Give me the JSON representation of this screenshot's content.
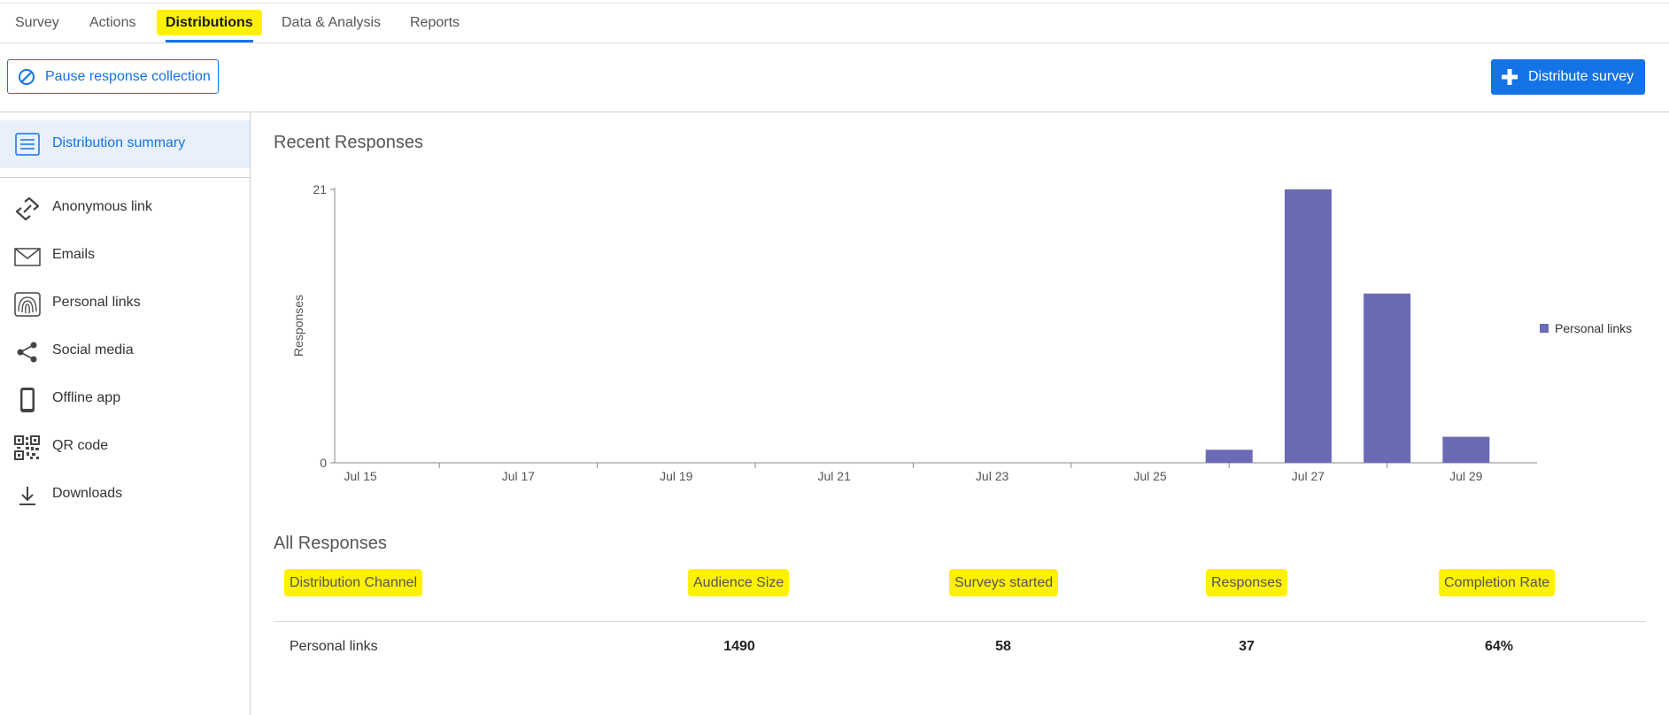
{
  "tabs": [
    {
      "label": "Survey"
    },
    {
      "label": "Actions"
    },
    {
      "label": "Distributions"
    },
    {
      "label": "Data & Analysis"
    },
    {
      "label": "Reports"
    }
  ],
  "toolbar": {
    "pause_label": "Pause response collection",
    "distribute_label": "Distribute survey"
  },
  "sidebar": {
    "summary_label": "Distribution summary",
    "items": [
      {
        "label": "Anonymous link",
        "icon": "link-icon"
      },
      {
        "label": "Emails",
        "icon": "envelope-icon"
      },
      {
        "label": "Personal links",
        "icon": "fingerprint-icon"
      },
      {
        "label": "Social media",
        "icon": "share-icon"
      },
      {
        "label": "Offline app",
        "icon": "phone-icon"
      },
      {
        "label": "QR code",
        "icon": "qr-code-icon"
      },
      {
        "label": "Downloads",
        "icon": "download-icon"
      }
    ]
  },
  "recent_title": "Recent Responses",
  "all_title": "All Responses",
  "chart_data": {
    "type": "bar",
    "categories": [
      "Jul 15",
      "Jul 16",
      "Jul 17",
      "Jul 18",
      "Jul 19",
      "Jul 20",
      "Jul 21",
      "Jul 22",
      "Jul 23",
      "Jul 24",
      "Jul 25",
      "Jul 26",
      "Jul 27",
      "Jul 28",
      "Jul 29"
    ],
    "tick_labels": [
      "Jul 15",
      "Jul 17",
      "Jul 19",
      "Jul 21",
      "Jul 23",
      "Jul 25",
      "Jul 27",
      "Jul 29"
    ],
    "series": [
      {
        "name": "Personal links",
        "values": [
          0,
          0,
          0,
          0,
          0,
          0,
          0,
          0,
          0,
          0,
          0,
          1,
          21,
          13,
          2
        ],
        "color": "#6b6bb5"
      }
    ],
    "ylabel": "Responses",
    "yticks": [
      0,
      21
    ],
    "ylim": [
      0,
      21
    ],
    "legend": "right"
  },
  "table": {
    "headers": [
      "Distribution Channel",
      "Audience Size",
      "Surveys started",
      "Responses",
      "Completion Rate"
    ],
    "rows": [
      {
        "channel": "Personal links",
        "audience": "1490",
        "started": "58",
        "responses": "37",
        "rate": "64%"
      }
    ]
  },
  "colors": {
    "accent": "#1473e6",
    "bar": "#6b6bb5",
    "highlight": "#fff200"
  }
}
